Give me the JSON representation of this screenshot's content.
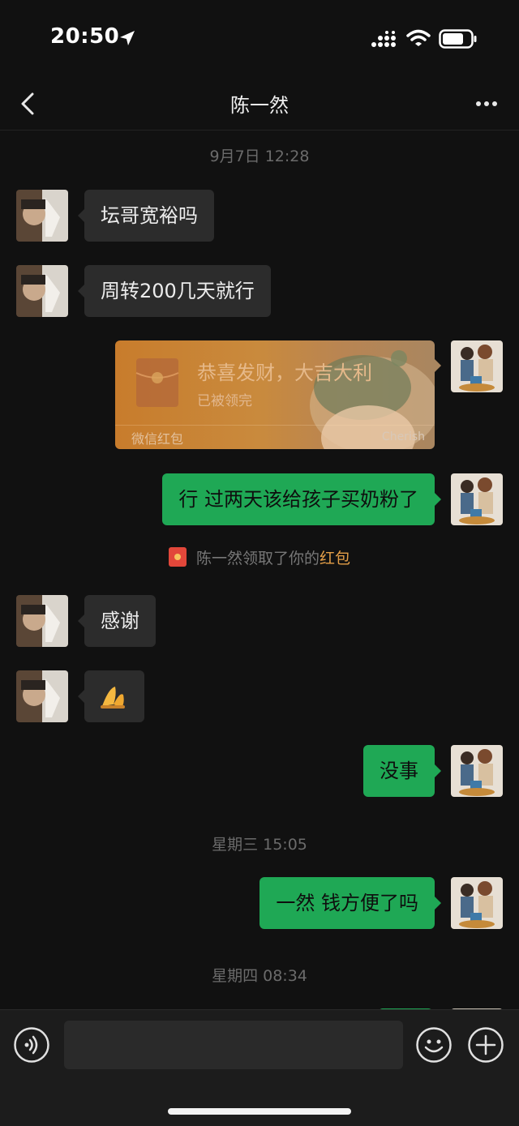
{
  "status_bar": {
    "time": "20:50"
  },
  "header": {
    "title": "陈一然"
  },
  "messages": {
    "ts1": "9月7日 12:28",
    "m1": "坛哥宽裕吗",
    "m2": "周转200几天就行",
    "red_packet": {
      "title": "恭喜发财，大吉大利",
      "status": "已被领完",
      "footer": "微信红包",
      "watermark": "Cherish"
    },
    "m3": "行 过两天该给孩子买奶粉了",
    "system": {
      "prefix": "陈一然领取了你的",
      "link": "红包"
    },
    "m4": "感谢",
    "m5": "🙏",
    "m6": "没事",
    "ts2": "星期三 15:05",
    "m7": "一然 钱方便了吗",
    "ts3": "星期四 08:34"
  },
  "colors": {
    "background": "#111111",
    "bubble_in": "#2c2c2c",
    "bubble_out": "#1fa855",
    "red_packet": "#c87c2c",
    "link": "#e49f48"
  },
  "icons": [
    "location-arrow-icon",
    "signal-icon",
    "wifi-icon",
    "battery-icon",
    "back-icon",
    "more-icon",
    "red-packet-icon",
    "voice-icon",
    "emoji-icon",
    "plus-icon"
  ]
}
